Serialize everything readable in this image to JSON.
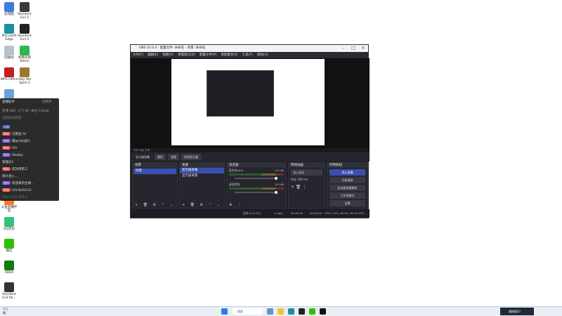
{
  "desktop": {
    "icons_left": [
      {
        "label": "此电脑",
        "color": "#3d7be0"
      },
      {
        "label": "Microsoft Edge",
        "color": "#1b8f9e"
      },
      {
        "label": "回收站",
        "color": "#b8c2cc"
      },
      {
        "label": "WPS Office",
        "color": "#c2201e"
      },
      {
        "label": "",
        "color": "#6aa2d6"
      }
    ],
    "icons_right": [
      {
        "label": "Resident Evil 2",
        "color": "#3a3a3a"
      },
      {
        "label": "Resident Evil 4",
        "color": "#222222"
      },
      {
        "label": "杀戮尖塔 Demo",
        "color": "#2db84d"
      },
      {
        "label": "Slay the Spire 2",
        "color": "#9a7b2a"
      }
    ],
    "icons_bottom": [
      {
        "label": "斗鱼直播伴侣",
        "color": "#ff7a1a"
      },
      {
        "label": "QQ音乐",
        "color": "#31c27c"
      },
      {
        "label": "微信",
        "color": "#2dc100"
      },
      {
        "label": "XBOX",
        "color": "#107c10"
      },
      {
        "label": "Resident Evil Re...",
        "color": "#333333"
      }
    ]
  },
  "live_panel": {
    "title": "直播助手",
    "close": "已断开",
    "stats": [
      "在线 304",
      "人气 39",
      "关注 1323w"
    ],
    "sub": "当前房间热度",
    "filter": "全部",
    "chat": [
      {
        "tag": "粉丝",
        "tag_color": "#e94b4b",
        "text": "已赠送 5k"
      },
      {
        "tag": "会员",
        "tag_color": "#7b4be9",
        "text": "赠gmkk送礼"
      },
      {
        "tag": "粉丝",
        "tag_color": "#e94b4b",
        "text": "XIV"
      },
      {
        "tag": "会员",
        "tag_color": "#7b4be9",
        "text": "Vitality"
      },
      {
        "tag": "",
        "tag_color": "#555555",
        "text": "管理员1"
      },
      {
        "tag": "粉丝",
        "tag_color": "#e94b4b",
        "text": "成功用第三"
      },
      {
        "tag": "",
        "tag_color": "#555555",
        "text": "观众进入..."
      },
      {
        "tag": "会员",
        "tag_color": "#7b4be9",
        "text": "欢迎来到主播..."
      },
      {
        "tag": "粉丝",
        "tag_color": "#e94b4b",
        "text": "k2k3k2k233"
      }
    ],
    "footer": "CPU 0.5% FPS 0"
  },
  "obs": {
    "title": "OBS 32.0.4 - 配置文件: 未命名 - 场景: 未命名",
    "menu": [
      "文件(F)",
      "编辑(E)",
      "视图(V)",
      "停靠窗口(D)",
      "配置文件(P)",
      "场景集合(S)",
      "工具(T)",
      "帮助(H)"
    ],
    "toolbar": [
      "显示器采集",
      "属性",
      "滤镜",
      "检测显示器"
    ],
    "scene_bar": "所有 场景 来源",
    "docks": {
      "scenes": {
        "title": "场景",
        "items": [
          "场景"
        ]
      },
      "sources": {
        "title": "来源",
        "items": [
          "显示器采集",
          "显示器采集"
        ]
      },
      "mixer": {
        "title": "混音器",
        "channels": [
          {
            "name": "麦克风/Aux",
            "db": "0.0 dB"
          },
          {
            "name": "桌面音频",
            "db": "0.0 dB"
          }
        ]
      },
      "transitions": {
        "title": "转场动画",
        "type": "淡入淡出",
        "duration_label": "时长",
        "duration": "300 ms"
      },
      "controls": {
        "title": "控制按钮",
        "buttons": [
          "停止直播",
          "开始录制",
          "启动虚拟摄像机",
          "工作室模式",
          "设置"
        ]
      }
    },
    "status": {
      "frames": "丢帧 0 (0.0%)",
      "kbps": "0 kb/s",
      "live": "00:00:00",
      "rec": "00:00:00",
      "cpu": "CPU: 0.5%, 60.00 / 60.00 FPS"
    }
  },
  "taskbar": {
    "weather": "7°C",
    "weather_sub": "晴",
    "search": "搜索",
    "notify": "通知提示!"
  }
}
